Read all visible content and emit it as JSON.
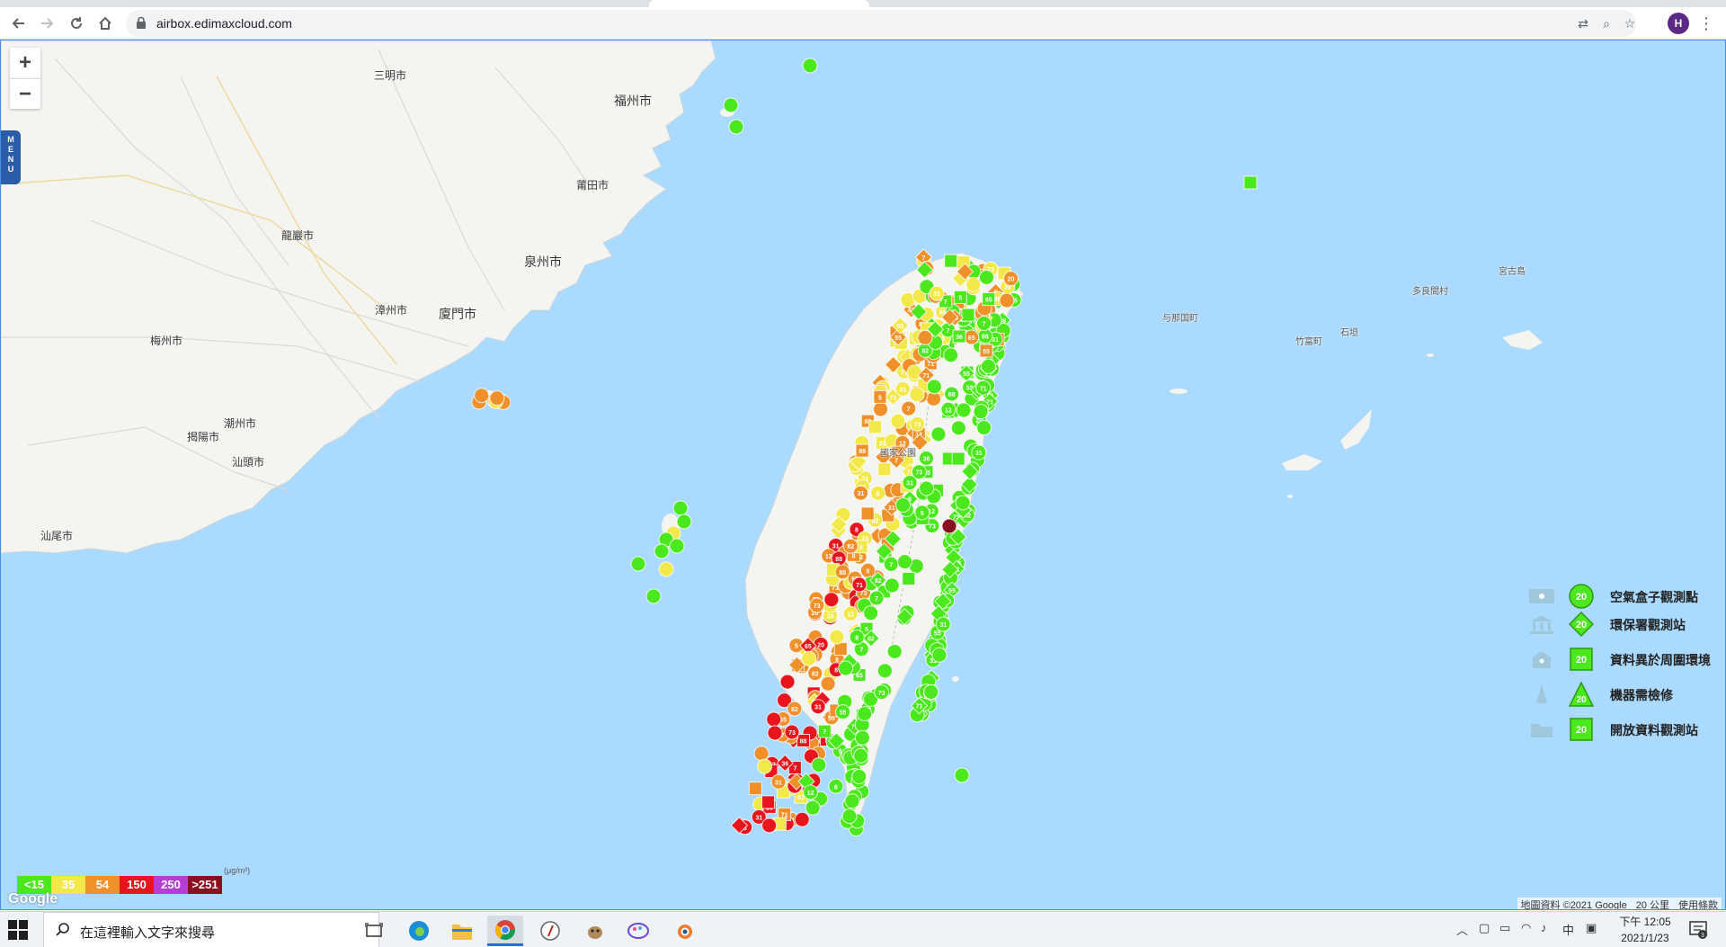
{
  "browser": {
    "url": "airbox.edimaxcloud.com",
    "avatar_letter": "H"
  },
  "map": {
    "zoom_in": "+",
    "zoom_out": "−",
    "menu": "MENU",
    "places": [
      {
        "id": "sanming",
        "name": "三明市"
      },
      {
        "id": "fuzhou",
        "name": "福州市"
      },
      {
        "id": "putian",
        "name": "莆田市"
      },
      {
        "id": "longyan",
        "name": "龍巖市"
      },
      {
        "id": "quanzhou",
        "name": "泉州市"
      },
      {
        "id": "zhangzhou",
        "name": "漳州市"
      },
      {
        "id": "xiamen",
        "name": "廈門市"
      },
      {
        "id": "meizhou",
        "name": "梅州市"
      },
      {
        "id": "chaozhou",
        "name": "潮州市"
      },
      {
        "id": "jieyang",
        "name": "揭陽市"
      },
      {
        "id": "shantou",
        "name": "汕頭市"
      },
      {
        "id": "shanwei",
        "name": "汕尾市"
      },
      {
        "id": "miyako",
        "name": "宮古島"
      },
      {
        "id": "tarama",
        "name": "多良間村"
      },
      {
        "id": "yonaguni",
        "name": "与那国町"
      },
      {
        "id": "taketomi",
        "name": "竹富町"
      },
      {
        "id": "ishigaki",
        "name": "石垣"
      },
      {
        "id": "park",
        "name": "國家公園"
      }
    ],
    "attribution": {
      "data": "地圖資料 ©2021 Google",
      "scale": "20 公里",
      "terms": "使用條款"
    },
    "google": "Google"
  },
  "legend": {
    "items": [
      {
        "label": "空氣盒子觀測點",
        "value": "20",
        "shape": "circle"
      },
      {
        "label": "環保署觀測站",
        "value": "20",
        "shape": "diamond"
      },
      {
        "label": "資料異於周圍環境",
        "value": "20",
        "shape": "square"
      },
      {
        "label": "機器需檢修",
        "value": "20",
        "shape": "triangle"
      },
      {
        "label": "開放資料觀測站",
        "value": "20",
        "shape": "square"
      }
    ]
  },
  "aqi_scale": {
    "unit": "(μg/m³)",
    "segments": [
      {
        "label": "<15",
        "color": "#4ce81e"
      },
      {
        "label": "35",
        "color": "#f2e84a"
      },
      {
        "label": "54",
        "color": "#f0902a"
      },
      {
        "label": "150",
        "color": "#e8141e"
      },
      {
        "label": "250",
        "color": "#b53fd6"
      },
      {
        "label": ">251",
        "color": "#8a1020"
      }
    ]
  },
  "markers": {
    "values": [
      "7",
      "8",
      "31",
      "88",
      "71",
      "73",
      "82",
      "55",
      "65",
      "36",
      "12",
      "20",
      "5"
    ]
  },
  "taskbar": {
    "search_placeholder": "在這裡輸入文字來搜尋",
    "tray_ime": "中",
    "time": "下午 12:05",
    "date": "2021/1/23",
    "notif_count": "3"
  },
  "colors": {
    "sea": "#aadaff",
    "land": "#f4f4f1",
    "green": "#4ce81e",
    "yellow": "#f2e84a",
    "orange": "#f0902a",
    "red": "#e8141e",
    "accent": "#2a5ca8"
  }
}
